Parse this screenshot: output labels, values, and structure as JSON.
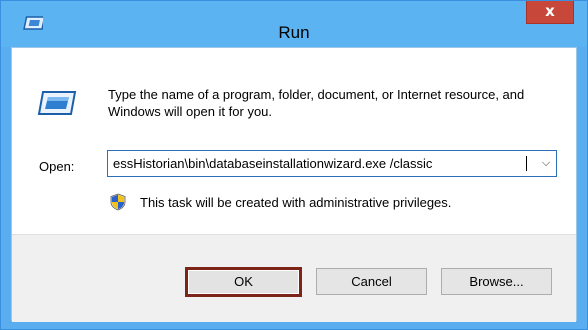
{
  "window": {
    "title": "Run",
    "close_label": "x"
  },
  "dialog": {
    "description": "Type the name of a program, folder, document, or Internet resource, and Windows will open it for you.",
    "open_label": "Open:",
    "open_value": "essHistorian\\bin\\databaseinstallationwizard.exe /classic",
    "admin_note": "This task will be created with administrative privileges."
  },
  "buttons": {
    "ok_label": "OK",
    "cancel_label": "Cancel",
    "browse_label": "Browse..."
  },
  "icons": {
    "title": "run-icon",
    "dialog": "run-icon",
    "shield": "uac-shield-icon",
    "dropdown": "chevron-down-icon"
  },
  "colors": {
    "titlebar": "#5cb3f2",
    "close_button": "#c7473b",
    "ok_highlight": "#7b2417"
  }
}
